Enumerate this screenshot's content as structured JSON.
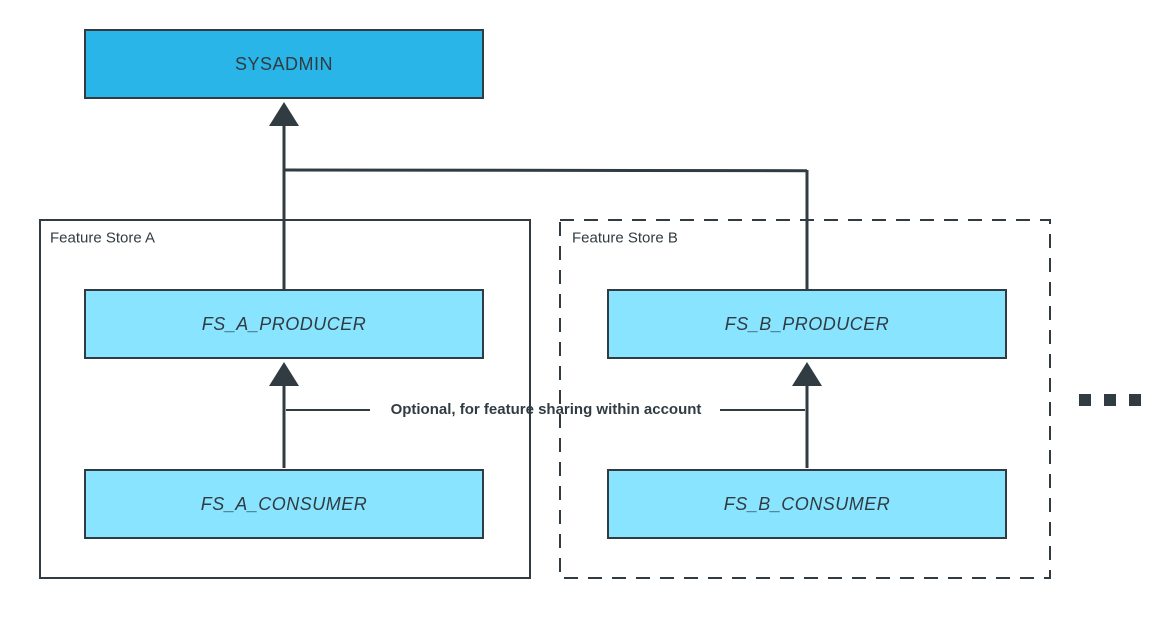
{
  "diagram": {
    "sysadmin": "SYSADMIN",
    "storeA": {
      "title": "Feature Store A",
      "producer": "FS_A_PRODUCER",
      "consumer": "FS_A_CONSUMER"
    },
    "storeB": {
      "title": "Feature Store B",
      "producer": "FS_B_PRODUCER",
      "consumer": "FS_B_CONSUMER"
    },
    "optional_label": "Optional, for feature sharing within account"
  },
  "colors": {
    "sysadmin_fill": "#29b5e8",
    "node_fill": "#88e4ff",
    "node_stroke": "#313c42",
    "line": "#313c42"
  }
}
